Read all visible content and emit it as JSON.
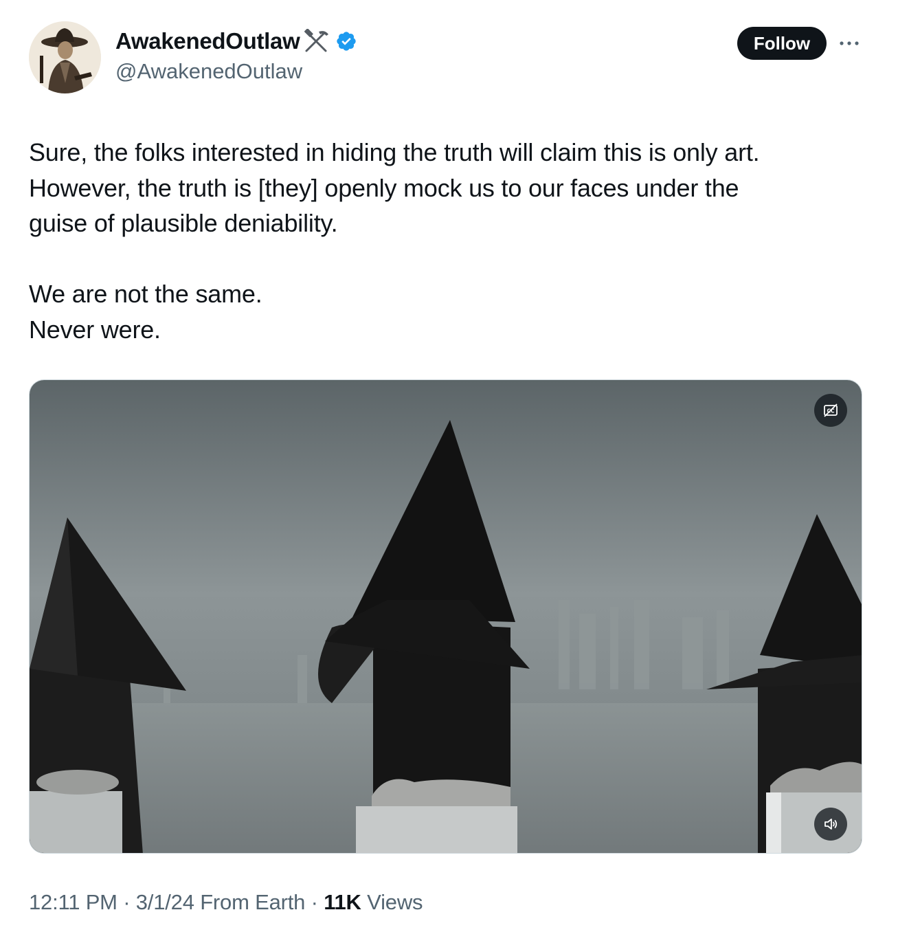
{
  "author": {
    "display_name": "AwakenedOutlaw",
    "name_emoji": "hammer-and-pick",
    "verified": true,
    "handle": "@AwakenedOutlaw",
    "avatar": "cowboy-portrait"
  },
  "actions": {
    "follow_label": "Follow",
    "more_icon": "more-icon"
  },
  "tweet": {
    "lines": [
      "Sure, the folks interested in hiding the truth will claim this is only art.",
      "However, the truth is [they] openly mock us to our faces under the",
      "guise of plausible deniability.",
      "",
      "We are not the same.",
      "Never were."
    ]
  },
  "media": {
    "type": "video",
    "captions_icon": "captions-off-icon",
    "sound_icon": "volume-icon"
  },
  "meta": {
    "time": "12:11 PM",
    "date": "3/1/24",
    "source": "From Earth",
    "views_count": "11K",
    "views_label": "Views",
    "separator": "·"
  },
  "colors": {
    "text": "#0f1419",
    "secondary": "#536471",
    "verified": "#1d9bf0",
    "follow_bg": "#0f1419"
  }
}
